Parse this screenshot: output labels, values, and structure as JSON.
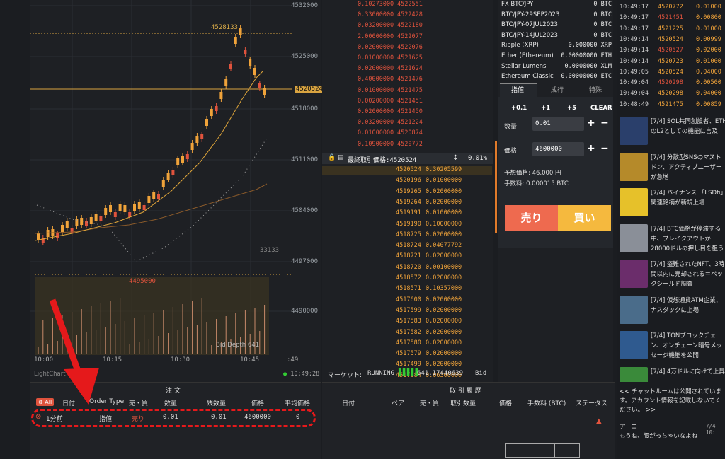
{
  "chart": {
    "y_ticks": [
      "4532000",
      "4525000",
      "4518000",
      "4511000",
      "4504000",
      "4497000",
      "4490000"
    ],
    "x_ticks": [
      "10:00",
      "10:15",
      "10:30",
      "10:45",
      ":49"
    ],
    "high_label": "4528133",
    "low_label": "4495000",
    "current_price": "4520524",
    "volume_label": "33133",
    "depth_label": "Bid Depth 641",
    "brand": "LightChart",
    "time": "10:49:28"
  },
  "orderbook": {
    "asks": [
      {
        "amount": "0.10273000",
        "price": "4522551"
      },
      {
        "amount": "0.33000000",
        "price": "4522428"
      },
      {
        "amount": "0.03200000",
        "price": "4522180"
      },
      {
        "amount": "2.00000000",
        "price": "4522077"
      },
      {
        "amount": "0.02000000",
        "price": "4522076"
      },
      {
        "amount": "0.01000000",
        "price": "4521625"
      },
      {
        "amount": "0.02000000",
        "price": "4521624"
      },
      {
        "amount": "0.40000000",
        "price": "4521476"
      },
      {
        "amount": "0.01000000",
        "price": "4521475"
      },
      {
        "amount": "0.00200000",
        "price": "4521451"
      },
      {
        "amount": "0.02000000",
        "price": "4521450"
      },
      {
        "amount": "0.03200000",
        "price": "4521224"
      },
      {
        "amount": "0.01000000",
        "price": "4520874"
      },
      {
        "amount": "0.10900000",
        "price": "4520772"
      }
    ],
    "last_label": "最終取引価格:4520524",
    "spread": "0.01%",
    "bids": [
      {
        "price": "4520524",
        "amount": "0.30205599"
      },
      {
        "price": "4520196",
        "amount": "0.01000000"
      },
      {
        "price": "4519265",
        "amount": "0.02000000"
      },
      {
        "price": "4519264",
        "amount": "0.02000000"
      },
      {
        "price": "4519191",
        "amount": "0.01000000"
      },
      {
        "price": "4519190",
        "amount": "0.10000000"
      },
      {
        "price": "4518725",
        "amount": "0.02000000"
      },
      {
        "price": "4518724",
        "amount": "0.04077792"
      },
      {
        "price": "4518721",
        "amount": "0.02000000"
      },
      {
        "price": "4518720",
        "amount": "0.00100000"
      },
      {
        "price": "4518572",
        "amount": "0.02000000"
      },
      {
        "price": "4518571",
        "amount": "0.10357000"
      },
      {
        "price": "4517600",
        "amount": "0.02000000"
      },
      {
        "price": "4517599",
        "amount": "0.02000000"
      },
      {
        "price": "4517583",
        "amount": "0.02000000"
      },
      {
        "price": "4517582",
        "amount": "0.02000000"
      },
      {
        "price": "4517580",
        "amount": "0.02000000"
      },
      {
        "price": "4517579",
        "amount": "0.02000000"
      },
      {
        "price": "4517499",
        "amount": "0.02000000"
      },
      {
        "price": "4517384",
        "amount": "0.06300000"
      }
    ],
    "market_label": "マーケット:",
    "market_status": "RUNNING",
    "market_value": "641.17440639",
    "bid_label": "Bid"
  },
  "assets": [
    {
      "name": "FX BTC/JPY",
      "value": "0 BTC"
    },
    {
      "name": "BTC/JPY-29SEP2023",
      "value": "0 BTC"
    },
    {
      "name": "BTC/JPY-07JUL2023",
      "value": "0 BTC"
    },
    {
      "name": "BTC/JPY-14JUL2023",
      "value": "0 BTC"
    },
    {
      "name": "Ripple (XRP)",
      "value": "0.000000 XRP"
    },
    {
      "name": "Ether (Ethereum)",
      "value": "0.00000000 ETH"
    },
    {
      "name": "Stellar Lumens",
      "value": "0.0000000 XLM"
    },
    {
      "name": "Ethereum Classic",
      "value": "0.00000000 ETC"
    }
  ],
  "orderform": {
    "tabs": [
      "指値",
      "成行",
      "特殊"
    ],
    "increments": [
      "+0.1",
      "+1",
      "+5",
      "CLEAR"
    ],
    "qty_label": "数量",
    "qty_value": "0.01",
    "price_label": "価格",
    "price_value": "4600000",
    "est_label": "予想価格: 46,000 円",
    "fee_label": "手数料: 0.000015 BTC",
    "sell": "売り",
    "buy": "買い"
  },
  "trades": [
    {
      "time": "10:49:17",
      "price": "4520772",
      "amount": "0.01000"
    },
    {
      "time": "10:49:17",
      "price": "4521451",
      "amount": "0.00800"
    },
    {
      "time": "10:49:17",
      "price": "4521225",
      "amount": "0.01000"
    },
    {
      "time": "10:49:14",
      "price": "4520524",
      "amount": "0.00999"
    },
    {
      "time": "10:49:14",
      "price": "4520527",
      "amount": "0.02000"
    },
    {
      "time": "10:49:14",
      "price": "4520723",
      "amount": "0.01000"
    },
    {
      "time": "10:49:05",
      "price": "4520524",
      "amount": "0.04000"
    },
    {
      "time": "10:49:04",
      "price": "4520298",
      "amount": "0.00500"
    },
    {
      "time": "10:49:04",
      "price": "4520298",
      "amount": "0.04000"
    },
    {
      "time": "10:48:49",
      "price": "4521475",
      "amount": "0.00859"
    }
  ],
  "news": [
    {
      "text": "[7/4] SOL共同創設者、ETHのL2としての機能に言及",
      "color": "#2a3f6b"
    },
    {
      "text": "[7/4] 分散型SNSのマストドン、アクティブユーザーが急増",
      "color": "#b58a2a"
    },
    {
      "text": "[7/4] バイナンス 「LSDfi」関連銘柄が新規上場",
      "color": "#e6c12a"
    },
    {
      "text": "[7/4] BTC価格が停滞する中、ブレイクアウトか28000ドルの押し目を狙うか",
      "color": "#8a8f98"
    },
    {
      "text": "[7/4] 盗難されたNFT、3時間以内に売却される＝ペックシールド調査",
      "color": "#6b2d6b"
    },
    {
      "text": "[7/4] 仮想通貨ATM企業、ナスダックに上場",
      "color": "#4a6c8a"
    },
    {
      "text": "[7/4] TONブロックチェーン、オンチェーン暗号メッセージ機能を公開",
      "color": "#2f5a8f"
    },
    {
      "text": "[7/4] 4万ドルに向けて上昇",
      "color": "#3a8a3a"
    }
  ],
  "orders": {
    "title": "注 文",
    "all_badge": "All",
    "headers": [
      "日付",
      "Order Type",
      "売・買",
      "数量",
      "残数量",
      "価格",
      "平均価格"
    ],
    "row": [
      "1分前",
      "指値",
      "売り",
      "0.01",
      "0.01",
      "4600000",
      "0"
    ]
  },
  "history": {
    "title": "取 引 履 歴",
    "headers": [
      "日付",
      "ペア",
      "売・買",
      "取引数量",
      "価格",
      "手数料 (BTC)",
      "ステータス"
    ]
  },
  "chat": {
    "notice": "<< チャットルームは公開されています。アカウント情報を記載しないでください。 >>",
    "user": "アーニー",
    "time": "7/4 10:",
    "message": "もうね、腰がっちゃいなよね"
  }
}
